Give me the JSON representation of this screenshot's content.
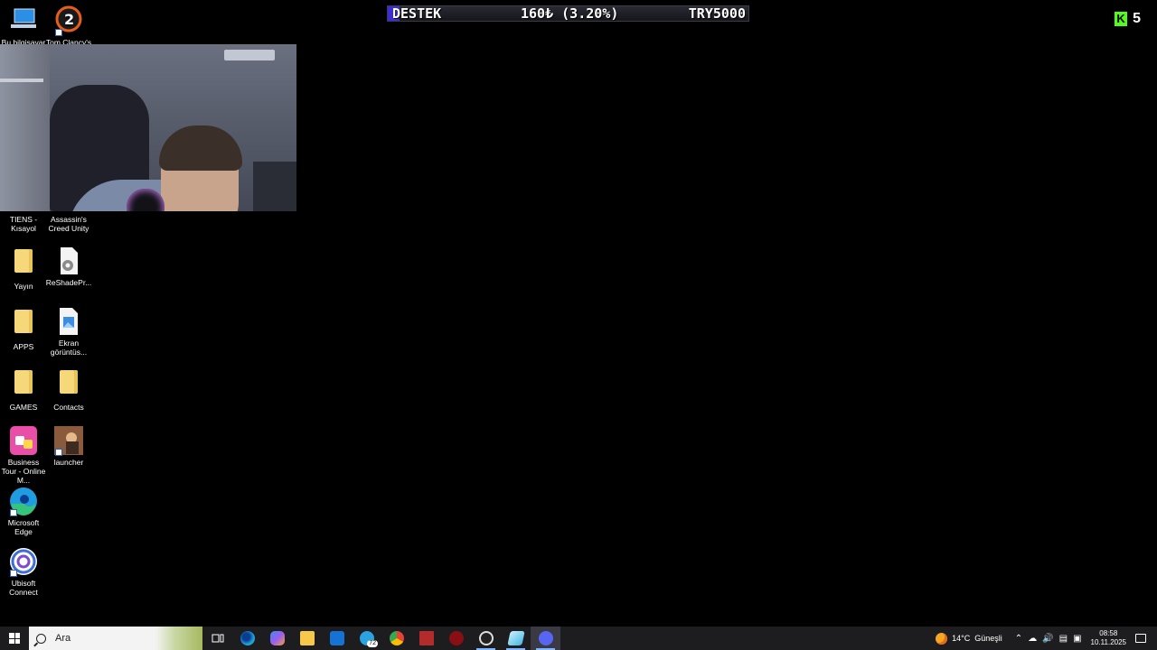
{
  "desktop": {
    "icons": [
      {
        "label": "Bu bilgisayar",
        "icon": "computer-icon"
      },
      {
        "label": "Tom Clancy's",
        "icon": "game-2-icon"
      },
      {
        "label": "TIENS - Kısayol",
        "icon": "shortcut-icon"
      },
      {
        "label": "Assassin's Creed Unity",
        "icon": "game-icon"
      },
      {
        "label": "Yayın",
        "icon": "folder-icon"
      },
      {
        "label": "ReShadePr...",
        "icon": "settings-file-icon"
      },
      {
        "label": "APPS",
        "icon": "folder-icon"
      },
      {
        "label": "Ekran görüntüs...",
        "icon": "image-file-icon"
      },
      {
        "label": "GAMES",
        "icon": "folder-icon"
      },
      {
        "label": "Contacts",
        "icon": "folder-icon"
      },
      {
        "label": "Business Tour - Online M...",
        "icon": "game-dice-icon"
      },
      {
        "label": "launcher",
        "icon": "launcher-icon"
      },
      {
        "label": "Microsoft Edge",
        "icon": "edge-icon"
      },
      {
        "label": "Ubisoft Connect",
        "icon": "ubisoft-icon"
      }
    ]
  },
  "donation_bar": {
    "label": "DESTEK",
    "amount": "160₺ (3.20%)",
    "goal": "TRY5000",
    "progress_percent": 3.2,
    "colors": {
      "fill": "#3b2bd9",
      "background": "#15151b"
    }
  },
  "kick_viewers": {
    "logo": "K",
    "count": "5",
    "color": "#53fc18"
  },
  "taskbar": {
    "search_placeholder": "Ara",
    "apps": [
      {
        "name": "task-view",
        "icon": "task-view-icon"
      },
      {
        "name": "edge",
        "icon": "edge-icon"
      },
      {
        "name": "copilot",
        "icon": "copilot-icon"
      },
      {
        "name": "file-explorer",
        "icon": "folder-icon"
      },
      {
        "name": "outlook",
        "icon": "outlook-icon"
      },
      {
        "name": "telegram",
        "icon": "telegram-icon",
        "badge": "72"
      },
      {
        "name": "chrome",
        "icon": "chrome-icon"
      },
      {
        "name": "voicemeeter",
        "icon": "voicemeeter-icon"
      },
      {
        "name": "obs-red",
        "icon": "red-app-icon"
      },
      {
        "name": "speed",
        "icon": "speedometer-icon"
      },
      {
        "name": "app-teal",
        "icon": "teal-app-icon"
      },
      {
        "name": "discord",
        "icon": "discord-icon"
      }
    ],
    "weather": {
      "temp": "14°C",
      "condition": "Güneşli"
    },
    "clock": {
      "time": "08:58",
      "date": "10.11.2025"
    }
  }
}
